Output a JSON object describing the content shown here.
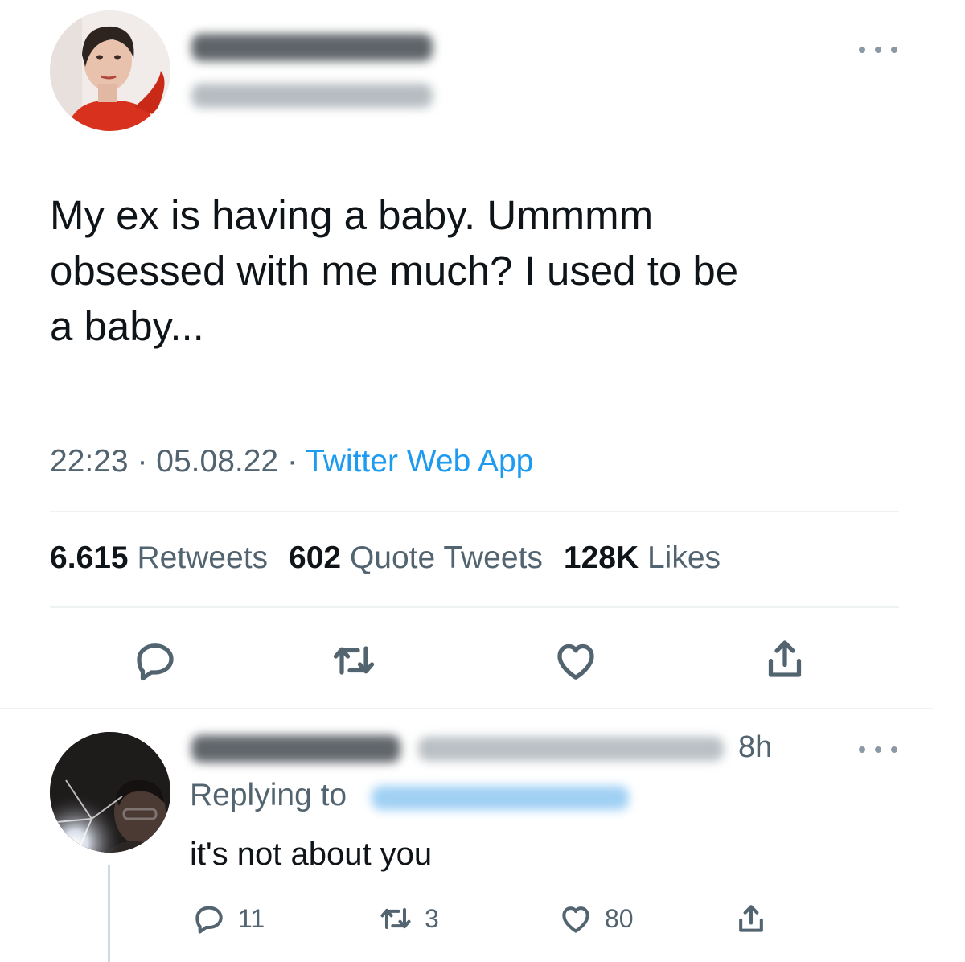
{
  "tweet": {
    "text": "My ex is having a baby. Ummmm\nobsessed with me much? I used to be\na baby...",
    "time": "22:23",
    "date": "05.08.22",
    "separator": "·",
    "source": "Twitter Web App",
    "stats": {
      "retweets_count": "6.615",
      "retweets_label": "Retweets",
      "quotes_count": "602",
      "quotes_label": "Quote Tweets",
      "likes_count": "128K",
      "likes_label": "Likes"
    },
    "actions": [
      "reply-icon",
      "retweet-icon",
      "like-icon",
      "share-icon"
    ]
  },
  "reply": {
    "time": "8h",
    "replying_label": "Replying to",
    "text": "it's not about you",
    "reply_count": "11",
    "retweet_count": "3",
    "like_count": "80"
  },
  "colors": {
    "text": "#0f1419",
    "secondary": "#536471",
    "link": "#1d9bf0",
    "divider": "#eff3f4"
  }
}
